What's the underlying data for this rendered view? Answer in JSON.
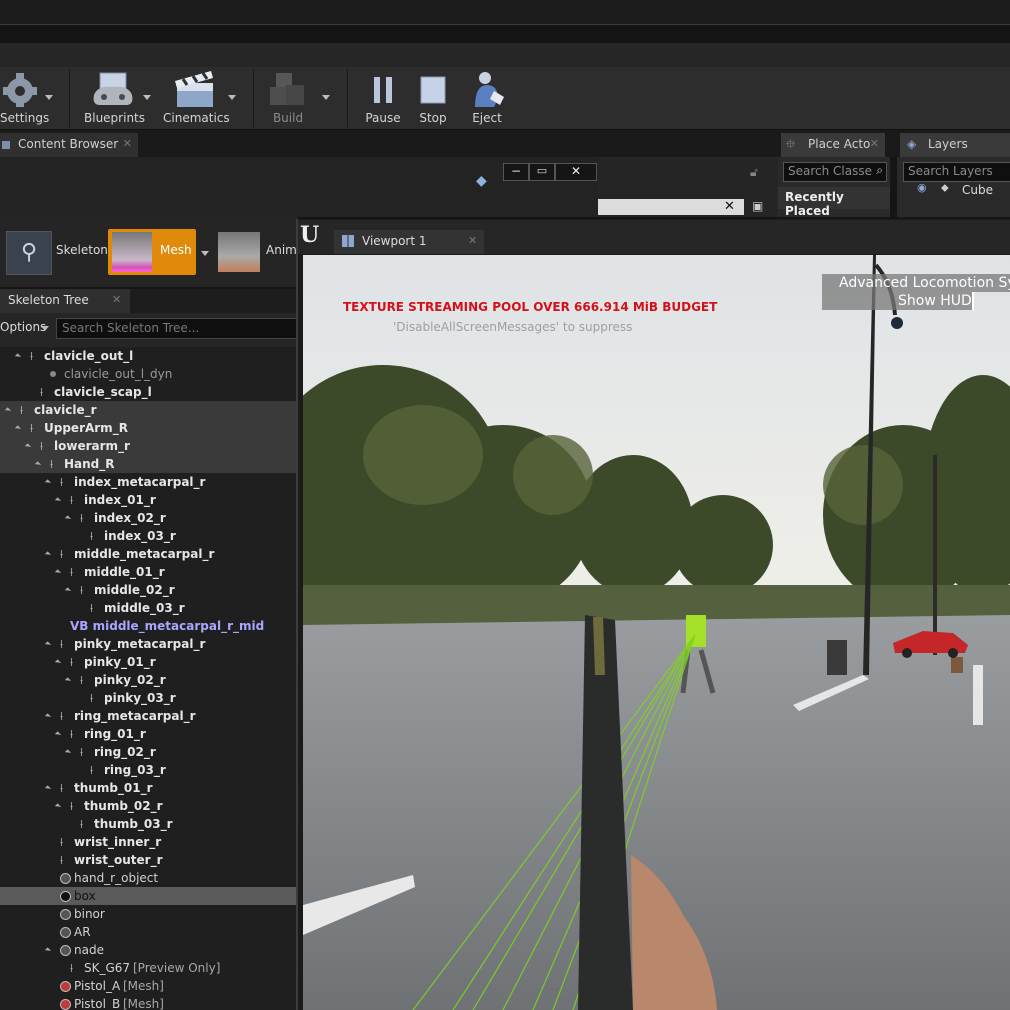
{
  "toolbar": {
    "settings_label": "Settings",
    "blueprints_label": "Blueprints",
    "cinematics_label": "Cinematics",
    "build_label": "Build",
    "pause_label": "Pause",
    "stop_label": "Stop",
    "eject_label": "Eject"
  },
  "tabs": {
    "content_browser": "Content Browser",
    "place_actors": "Place Acto",
    "layers": "Layers"
  },
  "place_actors": {
    "search_placeholder": "Search Classe",
    "recently_placed": "Recently Placed"
  },
  "layers": {
    "search_placeholder": "Search Layers",
    "items": [
      "Cube"
    ]
  },
  "asset_editor": {
    "modes": [
      "Skeleton",
      "Mesh",
      "Anim"
    ]
  },
  "skeleton_tree": {
    "tab_label": "Skeleton Tree",
    "options_label": "Options",
    "search_placeholder": "Search Skeleton Tree...",
    "rows": [
      {
        "label": "clavicle_out_l",
        "suffix": ""
      },
      {
        "label": "clavicle_out_l_dyn",
        "suffix": ""
      },
      {
        "label": "clavicle_scap_l",
        "suffix": ""
      },
      {
        "label": "clavicle_r",
        "suffix": ""
      },
      {
        "label": "UpperArm_R",
        "suffix": ""
      },
      {
        "label": "lowerarm_r",
        "suffix": ""
      },
      {
        "label": "Hand_R",
        "suffix": ""
      },
      {
        "label": "index_metacarpal_r",
        "suffix": ""
      },
      {
        "label": "index_01_r",
        "suffix": ""
      },
      {
        "label": "index_02_r",
        "suffix": ""
      },
      {
        "label": "index_03_r",
        "suffix": ""
      },
      {
        "label": "middle_metacarpal_r",
        "suffix": ""
      },
      {
        "label": "middle_01_r",
        "suffix": ""
      },
      {
        "label": "middle_02_r",
        "suffix": ""
      },
      {
        "label": "middle_03_r",
        "suffix": ""
      },
      {
        "label": "VB middle_metacarpal_r_mid",
        "suffix": ""
      },
      {
        "label": "pinky_metacarpal_r",
        "suffix": ""
      },
      {
        "label": "pinky_01_r",
        "suffix": ""
      },
      {
        "label": "pinky_02_r",
        "suffix": ""
      },
      {
        "label": "pinky_03_r",
        "suffix": ""
      },
      {
        "label": "ring_metacarpal_r",
        "suffix": ""
      },
      {
        "label": "ring_01_r",
        "suffix": ""
      },
      {
        "label": "ring_02_r",
        "suffix": ""
      },
      {
        "label": "ring_03_r",
        "suffix": ""
      },
      {
        "label": "thumb_01_r",
        "suffix": ""
      },
      {
        "label": "thumb_02_r",
        "suffix": ""
      },
      {
        "label": "thumb_03_r",
        "suffix": ""
      },
      {
        "label": "wrist_inner_r",
        "suffix": ""
      },
      {
        "label": "wrist_outer_r",
        "suffix": ""
      },
      {
        "label": "hand_r_object",
        "suffix": ""
      },
      {
        "label": "box",
        "suffix": ""
      },
      {
        "label": "binor",
        "suffix": ""
      },
      {
        "label": "AR",
        "suffix": ""
      },
      {
        "label": "nade",
        "suffix": ""
      },
      {
        "label": "SK_G67",
        "suffix": "[Preview Only]"
      },
      {
        "label": "Pistol_A",
        "suffix": "[Mesh]"
      },
      {
        "label": "Pistol_B",
        "suffix": "[Mesh]"
      }
    ]
  },
  "viewport": {
    "tab_label": "Viewport 1",
    "warning": "TEXTURE STREAMING POOL OVER 666.914 MiB BUDGET",
    "suppress_hint": "'DisableAllScreenMessages' to suppress",
    "hud_title": "Advanced Locomotion Syst",
    "hud_button": "Show HUD"
  },
  "colors": {
    "accent_orange": "#e08a0b",
    "warning_red": "#d4111a",
    "bone_link_blue": "#a9a6ff"
  }
}
